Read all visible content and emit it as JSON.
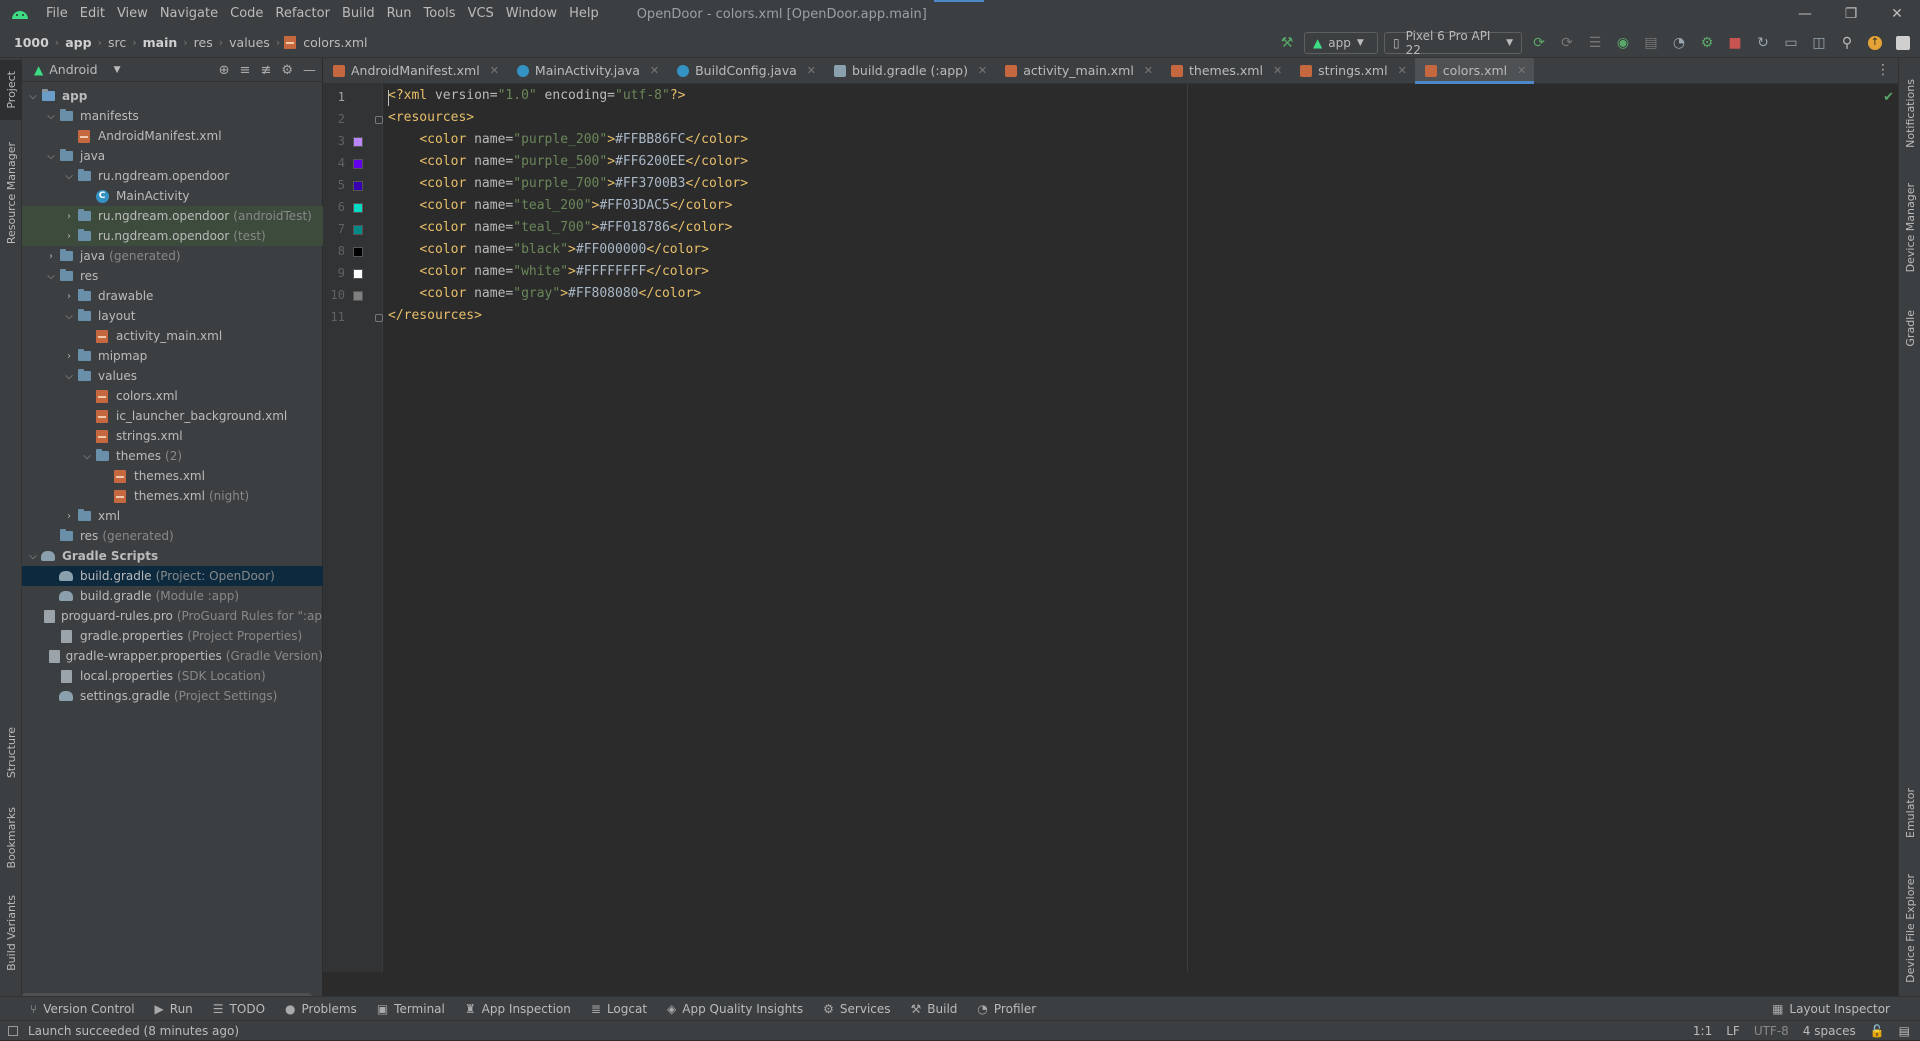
{
  "menu": {
    "items": [
      "File",
      "Edit",
      "View",
      "Navigate",
      "Code",
      "Refactor",
      "Build",
      "Run",
      "Tools",
      "VCS",
      "Window",
      "Help"
    ],
    "window_title": "OpenDoor - colors.xml [OpenDoor.app.main]"
  },
  "breadcrumb": [
    "1000",
    "app",
    "src",
    "main",
    "res",
    "values",
    "colors.xml"
  ],
  "toolbar": {
    "config": "app",
    "device": "Pixel 6 Pro API 22"
  },
  "project_panel": {
    "view_mode": "Android",
    "tree": [
      {
        "label": "app",
        "muted": "",
        "depth": 0,
        "arrow": "v",
        "icon": "module"
      },
      {
        "label": "manifests",
        "muted": "",
        "depth": 1,
        "arrow": "v",
        "icon": "folder"
      },
      {
        "label": "AndroidManifest.xml",
        "muted": "",
        "depth": 2,
        "arrow": "",
        "icon": "xml"
      },
      {
        "label": "java",
        "muted": "",
        "depth": 1,
        "arrow": "v",
        "icon": "folder"
      },
      {
        "label": "ru.ngdream.opendoor",
        "muted": "",
        "depth": 2,
        "arrow": "v",
        "icon": "folder"
      },
      {
        "label": "MainActivity",
        "muted": "",
        "depth": 3,
        "arrow": "",
        "icon": "class"
      },
      {
        "label": "ru.ngdream.opendoor",
        "muted": "(androidTest)",
        "depth": 2,
        "arrow": ">",
        "icon": "folder",
        "hl": "green"
      },
      {
        "label": "ru.ngdream.opendoor",
        "muted": "(test)",
        "depth": 2,
        "arrow": ">",
        "icon": "folder",
        "hl": "green"
      },
      {
        "label": "java",
        "muted": "(generated)",
        "depth": 1,
        "arrow": ">",
        "icon": "folder"
      },
      {
        "label": "res",
        "muted": "",
        "depth": 1,
        "arrow": "v",
        "icon": "folder"
      },
      {
        "label": "drawable",
        "muted": "",
        "depth": 2,
        "arrow": ">",
        "icon": "folder"
      },
      {
        "label": "layout",
        "muted": "",
        "depth": 2,
        "arrow": "v",
        "icon": "folder"
      },
      {
        "label": "activity_main.xml",
        "muted": "",
        "depth": 3,
        "arrow": "",
        "icon": "xml"
      },
      {
        "label": "mipmap",
        "muted": "",
        "depth": 2,
        "arrow": ">",
        "icon": "folder"
      },
      {
        "label": "values",
        "muted": "",
        "depth": 2,
        "arrow": "v",
        "icon": "folder"
      },
      {
        "label": "colors.xml",
        "muted": "",
        "depth": 3,
        "arrow": "",
        "icon": "xml"
      },
      {
        "label": "ic_launcher_background.xml",
        "muted": "",
        "depth": 3,
        "arrow": "",
        "icon": "xml"
      },
      {
        "label": "strings.xml",
        "muted": "",
        "depth": 3,
        "arrow": "",
        "icon": "xml"
      },
      {
        "label": "themes",
        "muted": "(2)",
        "depth": 3,
        "arrow": "v",
        "icon": "folder"
      },
      {
        "label": "themes.xml",
        "muted": "",
        "depth": 4,
        "arrow": "",
        "icon": "xml"
      },
      {
        "label": "themes.xml",
        "muted": "(night)",
        "depth": 4,
        "arrow": "",
        "icon": "xml"
      },
      {
        "label": "xml",
        "muted": "",
        "depth": 2,
        "arrow": ">",
        "icon": "folder"
      },
      {
        "label": "res",
        "muted": "(generated)",
        "depth": 1,
        "arrow": "",
        "icon": "folder"
      },
      {
        "label": "Gradle Scripts",
        "muted": "",
        "depth": 0,
        "arrow": "v",
        "icon": "gradle"
      },
      {
        "label": "build.gradle",
        "muted": "(Project: OpenDoor)",
        "depth": 1,
        "arrow": "",
        "icon": "gradle",
        "hl": "selected"
      },
      {
        "label": "build.gradle",
        "muted": "(Module :app)",
        "depth": 1,
        "arrow": "",
        "icon": "gradle"
      },
      {
        "label": "proguard-rules.pro",
        "muted": "(ProGuard Rules for \":app\")",
        "depth": 1,
        "arrow": "",
        "icon": "props"
      },
      {
        "label": "gradle.properties",
        "muted": "(Project Properties)",
        "depth": 1,
        "arrow": "",
        "icon": "props"
      },
      {
        "label": "gradle-wrapper.properties",
        "muted": "(Gradle Version)",
        "depth": 1,
        "arrow": "",
        "icon": "props"
      },
      {
        "label": "local.properties",
        "muted": "(SDK Location)",
        "depth": 1,
        "arrow": "",
        "icon": "props"
      },
      {
        "label": "settings.gradle",
        "muted": "(Project Settings)",
        "depth": 1,
        "arrow": "",
        "icon": "gradle"
      }
    ]
  },
  "editor_tabs": [
    {
      "label": "AndroidManifest.xml",
      "icon": "xml",
      "active": false
    },
    {
      "label": "MainActivity.java",
      "icon": "class",
      "active": false
    },
    {
      "label": "BuildConfig.java",
      "icon": "class",
      "active": false
    },
    {
      "label": "build.gradle (:app)",
      "icon": "gradle",
      "active": false
    },
    {
      "label": "activity_main.xml",
      "icon": "xml",
      "active": false
    },
    {
      "label": "themes.xml",
      "icon": "xml",
      "active": false
    },
    {
      "label": "strings.xml",
      "icon": "xml",
      "active": false
    },
    {
      "label": "colors.xml",
      "icon": "xml",
      "active": true
    }
  ],
  "code": {
    "prolog": {
      "open": "<?xml ",
      "version_attr": "version=",
      "version_val": "\"1.0\"",
      "enc_attr": " encoding=",
      "enc_val": "\"utf-8\"",
      "close": "?>"
    },
    "root_open": "<resources>",
    "root_close": "</resources>",
    "colors": [
      {
        "name": "purple_200",
        "value": "#FFBB86FC",
        "swatch": "#BB86FC"
      },
      {
        "name": "purple_500",
        "value": "#FF6200EE",
        "swatch": "#6200EE"
      },
      {
        "name": "purple_700",
        "value": "#FF3700B3",
        "swatch": "#3700B3"
      },
      {
        "name": "teal_200",
        "value": "#FF03DAC5",
        "swatch": "#03DAC5"
      },
      {
        "name": "teal_700",
        "value": "#FF018786",
        "swatch": "#018786"
      },
      {
        "name": "black",
        "value": "#FF000000",
        "swatch": "#000000"
      },
      {
        "name": "white",
        "value": "#FFFFFFFF",
        "swatch": "#FFFFFF"
      },
      {
        "name": "gray",
        "value": "#FF808080",
        "swatch": "#808080"
      }
    ],
    "line_numbers": [
      "1",
      "2",
      "3",
      "4",
      "5",
      "6",
      "7",
      "8",
      "9",
      "10",
      "11"
    ]
  },
  "left_strip": [
    "Project",
    "Resource Manager",
    "Structure",
    "Bookmarks",
    "Build Variants"
  ],
  "right_strip": [
    "Notifications",
    "Device Manager",
    "Gradle",
    "Emulator",
    "Device File Explorer"
  ],
  "bottom_tabs": [
    {
      "label": "Version Control",
      "icon": "branch-icon"
    },
    {
      "label": "Run",
      "icon": "run-icon"
    },
    {
      "label": "TODO",
      "icon": "list-icon"
    },
    {
      "label": "Problems",
      "icon": "problems-icon"
    },
    {
      "label": "Terminal",
      "icon": "terminal-icon"
    },
    {
      "label": "App Inspection",
      "icon": "inspection-icon"
    },
    {
      "label": "Logcat",
      "icon": "logcat-icon"
    },
    {
      "label": "App Quality Insights",
      "icon": "insights-icon"
    },
    {
      "label": "Services",
      "icon": "services-icon"
    },
    {
      "label": "Build",
      "icon": "hammer-icon"
    },
    {
      "label": "Profiler",
      "icon": "profiler-icon"
    }
  ],
  "layout_inspector": "Layout Inspector",
  "status": {
    "message": "Launch succeeded (8 minutes ago)",
    "position": "1:1",
    "line_sep": "LF",
    "encoding": "UTF-8",
    "indent": "4 spaces"
  }
}
